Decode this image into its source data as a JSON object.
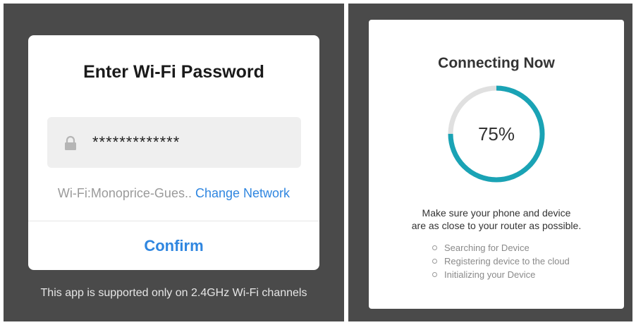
{
  "password_dialog": {
    "title": "Enter Wi-Fi Password",
    "password_value": "*************",
    "lock_icon": "lock-icon",
    "network_label": "Wi-Fi:Monoprice-Gues..",
    "change_network_label": "Change Network",
    "confirm_label": "Confirm",
    "support_note": "This app is supported only on 2.4GHz Wi-Fi channels",
    "accent_color": "#2f86e0"
  },
  "connecting": {
    "title": "Connecting Now",
    "progress_percent": 75,
    "progress_label": "75%",
    "hint_line1": "Make sure your phone and device",
    "hint_line2": "are as close to your router as possible.",
    "steps": [
      "Searching for Device",
      "Registering device to the cloud",
      "Initializing your Device"
    ],
    "ring_color": "#1aa3b5",
    "ring_track_color": "#e0e0e0"
  }
}
